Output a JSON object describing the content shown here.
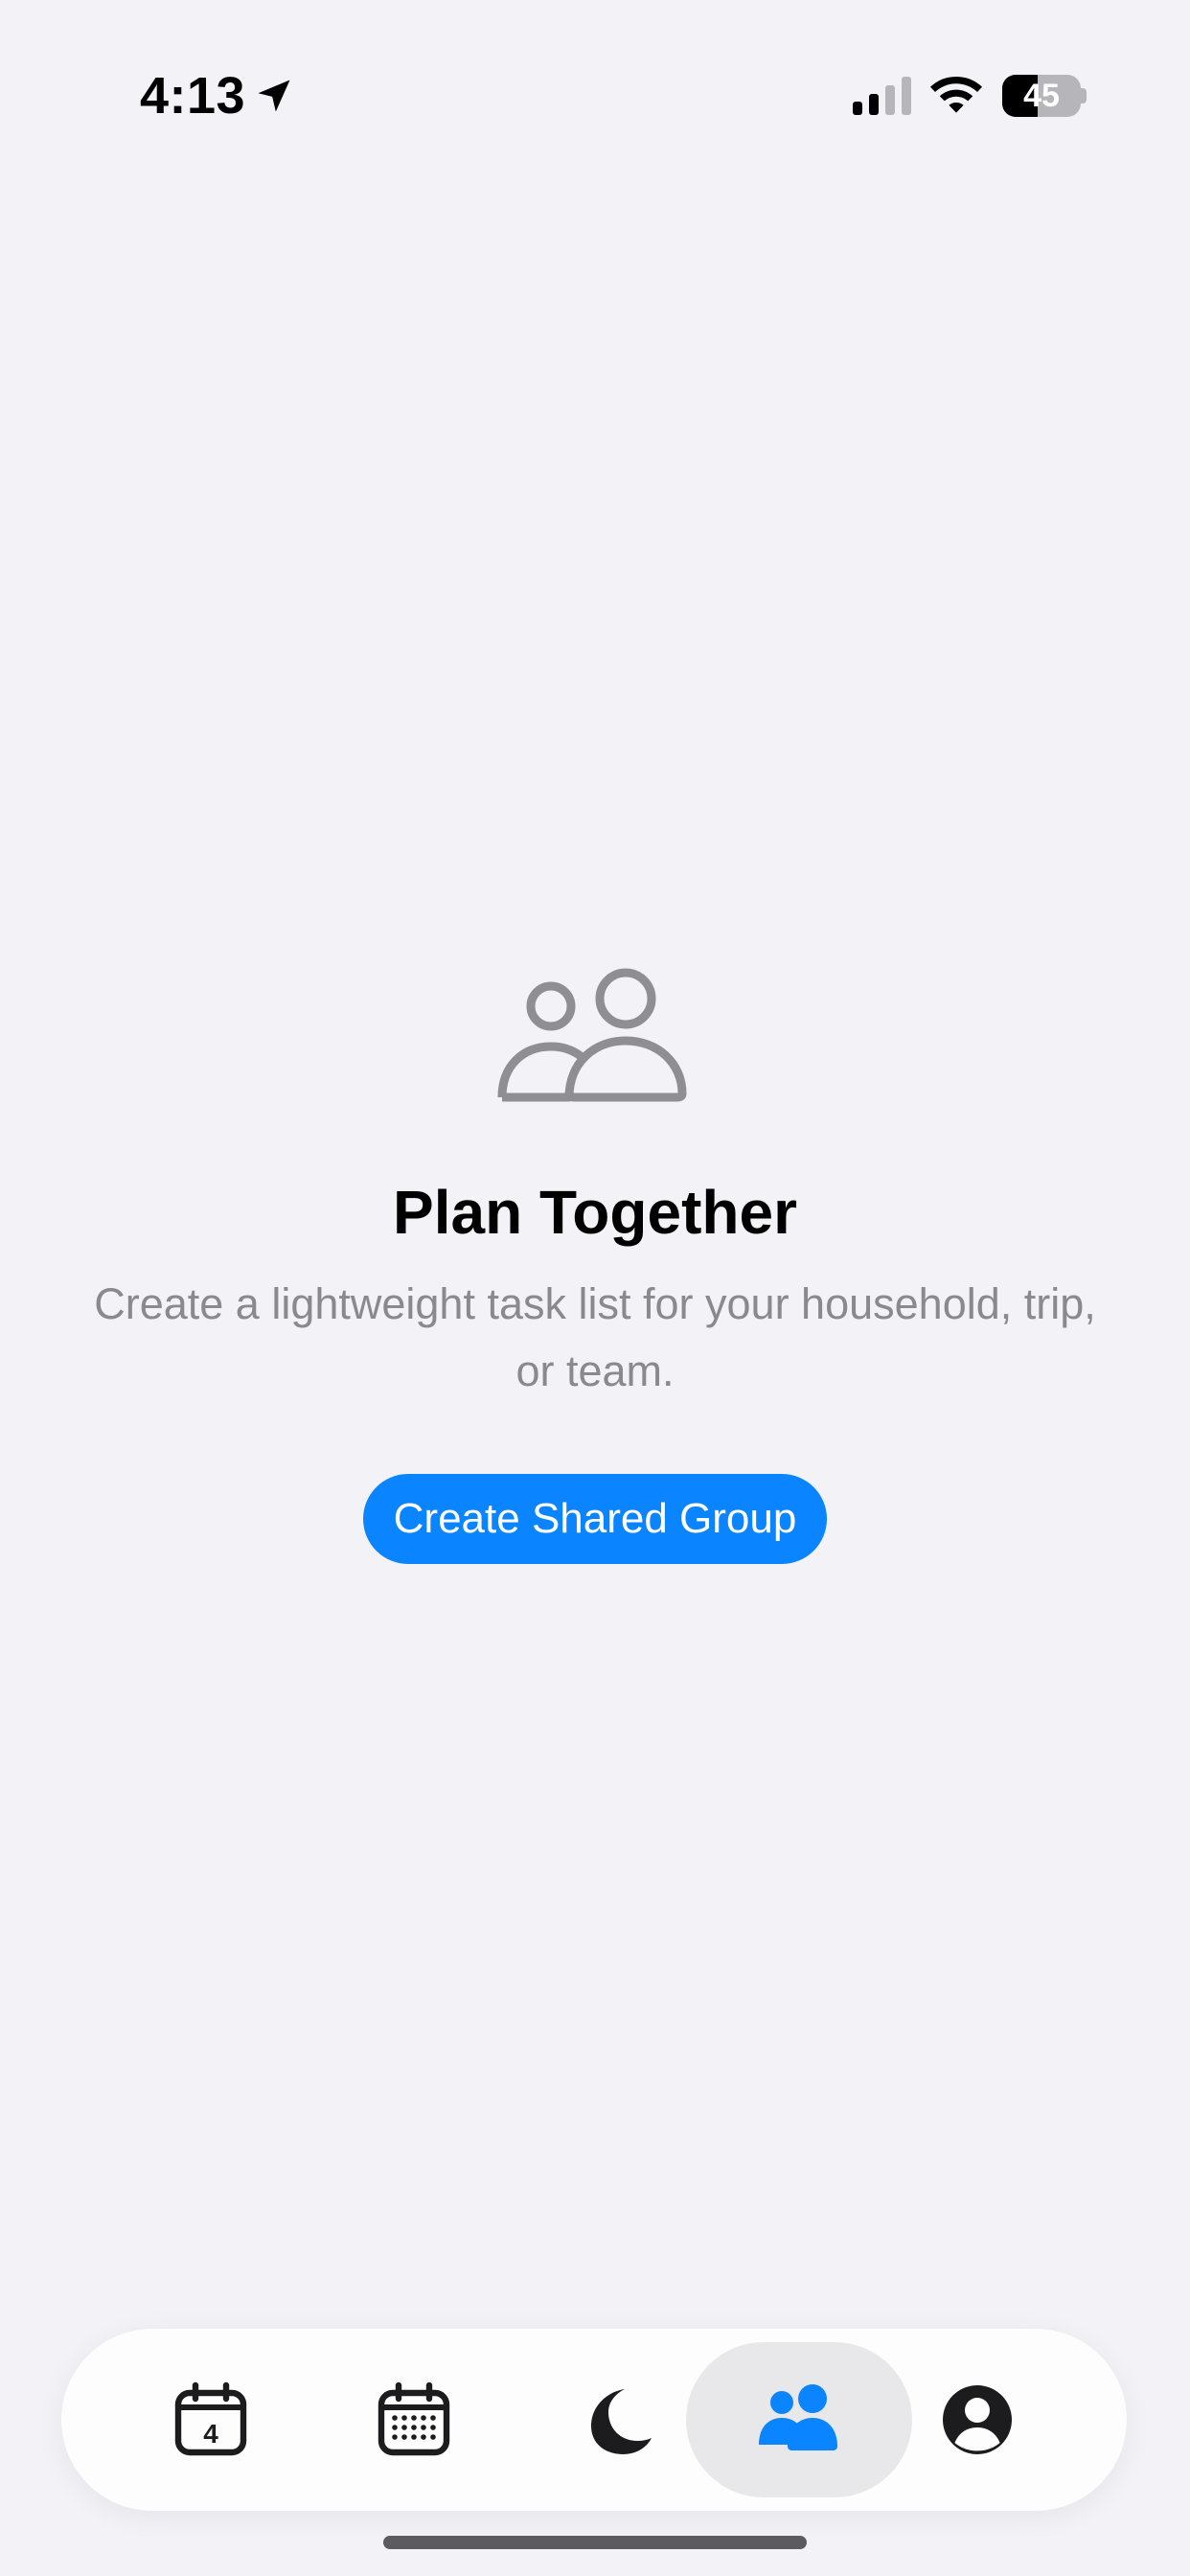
{
  "status_bar": {
    "time": "4:13",
    "battery_percent": 45,
    "battery_label": "45",
    "icons": [
      "location-arrow-icon",
      "cellular-signal-icon",
      "wifi-icon",
      "battery-icon"
    ]
  },
  "empty_state": {
    "icon": "people-icon",
    "title": "Plan Together",
    "description": "Create a lightweight task list for your household, trip, or team.",
    "button_label": "Create Shared Group"
  },
  "tab_bar": {
    "selected_index": 3,
    "tabs": [
      {
        "icon": "calendar-day-icon",
        "badge": "4"
      },
      {
        "icon": "calendar-month-icon"
      },
      {
        "icon": "moon-icon"
      },
      {
        "icon": "people-fill-icon"
      },
      {
        "icon": "person-circle-icon"
      }
    ]
  },
  "colors": {
    "background": "#f2f2f7",
    "accent": "#0a84ff",
    "secondary_text": "#8a8a8e",
    "icon_gray": "#8e8e93",
    "tab_active_bg": "#e8e8ea"
  }
}
